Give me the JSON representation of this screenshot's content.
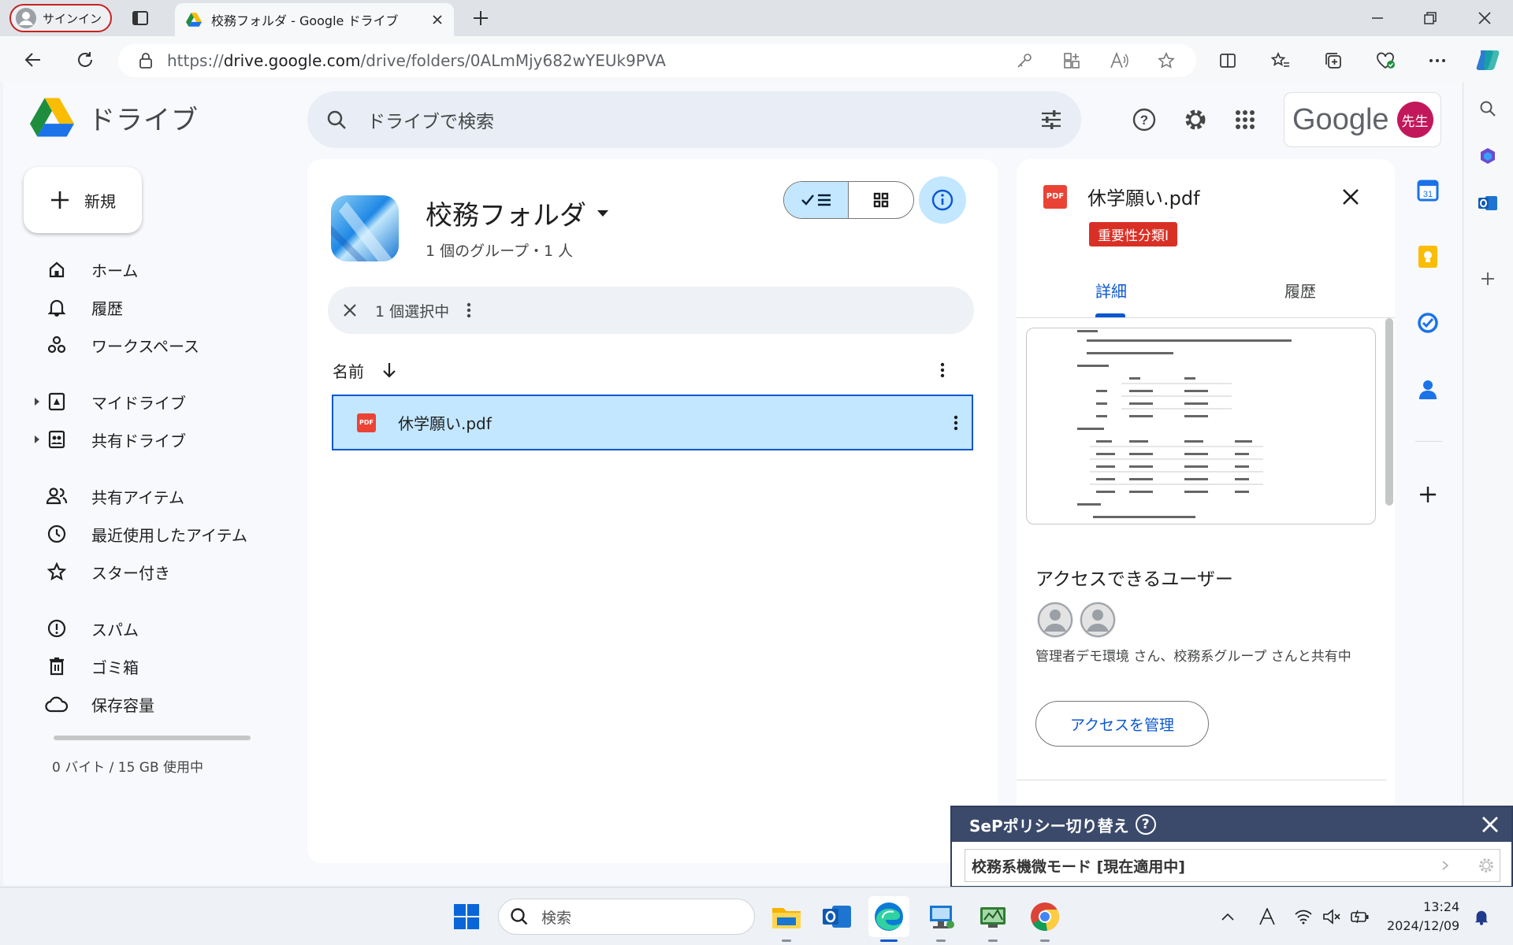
{
  "browser": {
    "signin_label": "サインイン",
    "tab_title": "校務フォルダ - Google ドライブ",
    "url_prefix": "https://",
    "url_host": "drive.google.com",
    "url_path": "/drive/folders/0ALmMjy682wYEUk9PVA"
  },
  "drive": {
    "app_name": "ドライブ",
    "search_placeholder": "ドライブで検索",
    "google_text": "Google",
    "avatar_label": "先生",
    "new_button": "新規",
    "nav": [
      {
        "label": "ホーム",
        "icon": "home-icon"
      },
      {
        "label": "履歴",
        "icon": "bell-icon"
      },
      {
        "label": "ワークスペース",
        "icon": "workspace-icon"
      },
      {
        "label": "マイドライブ",
        "icon": "my-drive-icon"
      },
      {
        "label": "共有ドライブ",
        "icon": "shared-drive-icon"
      },
      {
        "label": "共有アイテム",
        "icon": "people-icon"
      },
      {
        "label": "最近使用したアイテム",
        "icon": "clock-icon"
      },
      {
        "label": "スター付き",
        "icon": "star-icon"
      },
      {
        "label": "スパム",
        "icon": "spam-icon"
      },
      {
        "label": "ゴミ箱",
        "icon": "trash-icon"
      },
      {
        "label": "保存容量",
        "icon": "cloud-icon"
      }
    ],
    "storage_text": "0 バイト / 15 GB 使用中"
  },
  "folder": {
    "title": "校務フォルダ",
    "subtitle": "1 個のグループ・1 人",
    "selection_text": "1 個選択中",
    "column_name": "名前",
    "files": [
      {
        "name": "休学願い.pdf",
        "type_badge": "PDF",
        "selected": true
      }
    ]
  },
  "details": {
    "file_name": "休学願い.pdf",
    "label_badge": "重要性分類Ⅰ",
    "tab_details": "詳細",
    "tab_activity": "履歴",
    "access_heading": "アクセスできるユーザー",
    "shared_with": "管理者デモ環境 さん、校務系グループ さんと共有中",
    "manage_access": "アクセスを管理"
  },
  "sep_popup": {
    "title": "SePポリシー切り替え",
    "help": "?",
    "current_mode": "校務系機微モード [現在適用中]"
  },
  "taskbar": {
    "search_placeholder": "検索",
    "time": "13:24",
    "date": "2024/12/09"
  },
  "colors": {
    "accent": "#0b57d0",
    "selected_bg": "#c2e7ff",
    "badge_red": "#d93025",
    "popup_header": "#3b4a6b"
  }
}
